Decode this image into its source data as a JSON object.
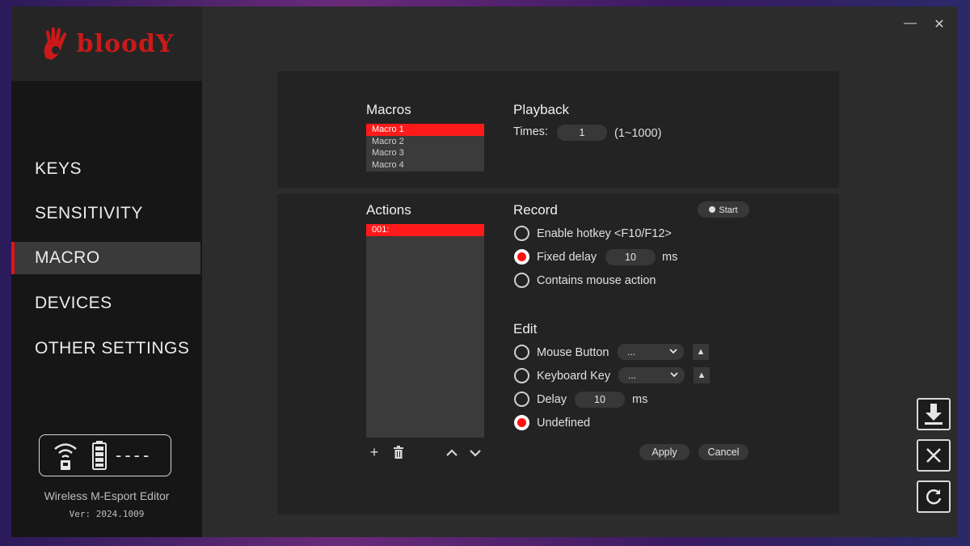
{
  "app": {
    "logo_text": "bloodY",
    "name": "Wireless M-Esport Editor",
    "version": "Ver: 2024.1009"
  },
  "window_controls": {
    "minimize": "—",
    "close": "✕"
  },
  "sidebar": {
    "items": [
      {
        "label": "KEYS",
        "active": false
      },
      {
        "label": "SENSITIVITY",
        "active": false
      },
      {
        "label": "MACRO",
        "active": true
      },
      {
        "label": "DEVICES",
        "active": false
      },
      {
        "label": "OTHER SETTINGS",
        "active": false
      }
    ],
    "status": {
      "battery_text": "----"
    }
  },
  "macros": {
    "title": "Macros",
    "items": [
      "Macro 1",
      "Macro 2",
      "Macro 3",
      "Macro 4"
    ],
    "selected_index": 0
  },
  "playback": {
    "title": "Playback",
    "times_label": "Times:",
    "times_value": "1",
    "times_range": "(1~1000)"
  },
  "actions": {
    "title": "Actions",
    "items": [
      "001:"
    ],
    "selected_index": 0
  },
  "record": {
    "title": "Record",
    "start_label": "Start",
    "options": [
      {
        "label": "Enable hotkey <F10/F12>",
        "checked": false
      },
      {
        "label": "Fixed delay",
        "checked": true,
        "value": "10",
        "unit": "ms"
      },
      {
        "label": "Contains mouse action",
        "checked": false
      }
    ]
  },
  "edit": {
    "title": "Edit",
    "mouse_button": {
      "label": "Mouse Button",
      "value": "...",
      "checked": false
    },
    "keyboard_key": {
      "label": "Keyboard Key",
      "value": "...",
      "checked": false
    },
    "delay": {
      "label": "Delay",
      "value": "10",
      "unit": "ms",
      "checked": false
    },
    "undefined": {
      "label": "Undefined",
      "checked": true
    },
    "apply_label": "Apply",
    "cancel_label": "Cancel"
  },
  "colors": {
    "accent": "#ff1a1a",
    "panel": "#232323",
    "background": "#2c2c2c",
    "sidebar": "#161616"
  }
}
